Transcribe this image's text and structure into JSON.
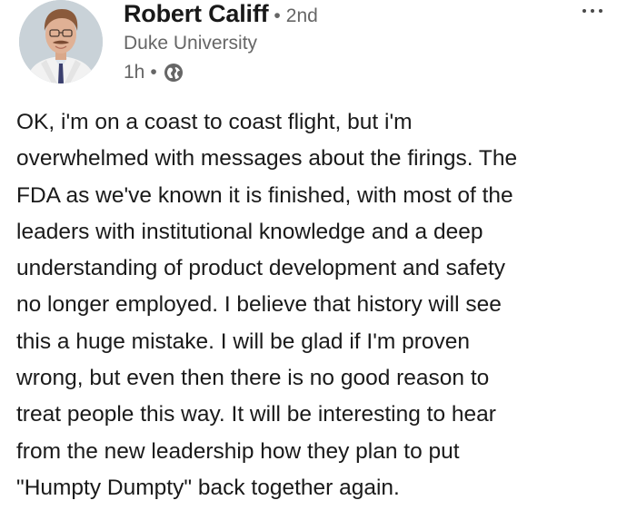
{
  "author": {
    "name": "Robert Califf",
    "degree_separator": "•",
    "degree": "2nd",
    "headline": "Duke University"
  },
  "meta": {
    "time": "1h",
    "separator": "•",
    "visibility_icon": "globe-icon"
  },
  "menu": {
    "icon": "more-horizontal-icon"
  },
  "post": {
    "text": "OK, i'm on a coast to coast flight, but i'm\noverwhelmed with messages about the firings. The\nFDA as we've known it is finished, with most of the\nleaders with institutional knowledge and a deep\nunderstanding of product development and safety\nno longer employed. I believe that history will see\nthis a huge mistake. I will be glad if I'm proven\nwrong, but even then there is no good reason to\ntreat people this way. It will be interesting to hear\nfrom the new leadership how they plan to put\n\"Humpty Dumpty\" back together again."
  },
  "colors": {
    "name_text": "#191919",
    "secondary_text": "#666666",
    "body_text": "#1a1a1a",
    "background": "#ffffff"
  }
}
